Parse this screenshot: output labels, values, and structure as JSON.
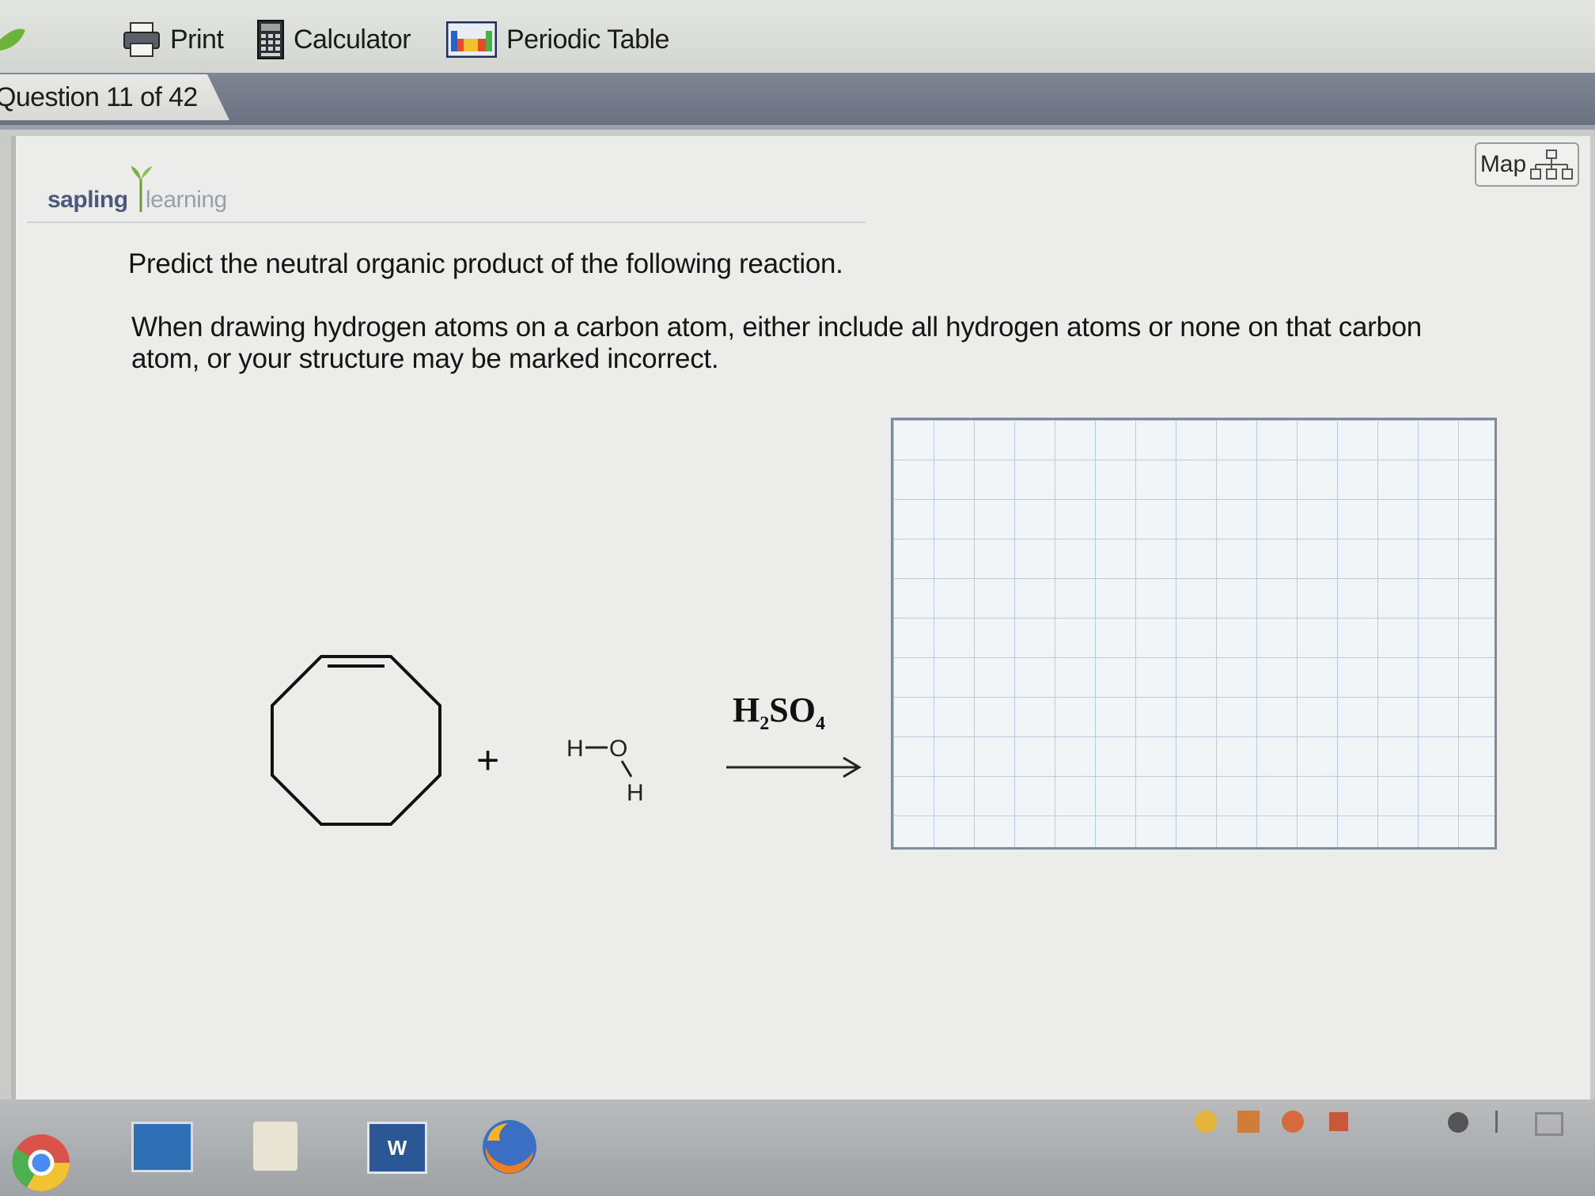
{
  "toolbar": {
    "print_label": "Print",
    "calculator_label": "Calculator",
    "periodic_table_label": "Periodic Table"
  },
  "question_tab": {
    "label": "Question 11 of 42"
  },
  "map_button": {
    "label": "Map"
  },
  "brand": {
    "part1": "sapling",
    "part2": "learning"
  },
  "question": {
    "prompt": "Predict the neutral organic product of the following reaction.",
    "instruction": "When drawing hydrogen atoms on a carbon atom, either include all hydrogen atoms or none on that carbon atom, or your structure may be marked incorrect."
  },
  "reaction": {
    "reactant_1": "cyclooctene",
    "plus": "+",
    "water_h1": "H",
    "water_o": "O",
    "water_h2": "H",
    "reagent_h": "H",
    "reagent_h_sub": "2",
    "reagent_so": "SO",
    "reagent_so_sub": "4"
  },
  "taskbar": {
    "apps": [
      "chrome-icon",
      "lenovo-icon",
      "file-explorer-icon",
      "word-icon",
      "firefox-icon"
    ]
  }
}
